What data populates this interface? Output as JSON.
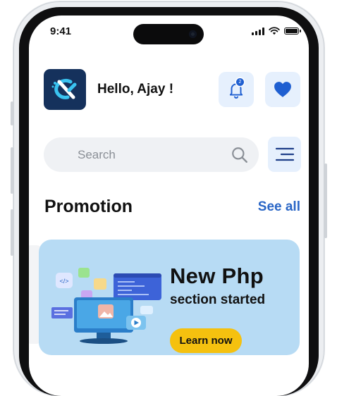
{
  "status_bar": {
    "time": "9:41"
  },
  "header": {
    "greeting": "Hello, Ajay !",
    "notification_count": "2"
  },
  "search": {
    "placeholder": "Search"
  },
  "promotion": {
    "title": "Promotion",
    "see_all": "See all"
  },
  "promo_card": {
    "title": "New Php",
    "subtitle": "section started",
    "button": "Learn now",
    "illustration_code_tag": "</>",
    "background": "#b7dbf4",
    "button_color": "#f5c10f"
  },
  "colors": {
    "accent": "#2a66c6",
    "icon_bg": "#e6f0fd",
    "logo_bg": "#15315c"
  }
}
